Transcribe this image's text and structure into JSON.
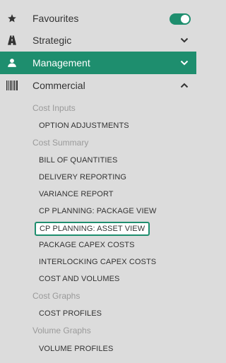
{
  "nav": {
    "items": [
      {
        "label": "Favourites",
        "icon": "star-icon"
      },
      {
        "label": "Strategic",
        "icon": "road-icon"
      },
      {
        "label": "Management",
        "icon": "user-icon"
      },
      {
        "label": "Commercial",
        "icon": "barcode-icon"
      }
    ],
    "favourites_toggle": "on",
    "accent_color": "#1e8e6e"
  },
  "commercial": {
    "groups": {
      "cost_inputs": "Cost Inputs",
      "cost_summary": "Cost Summary",
      "cost_graphs": "Cost Graphs",
      "volume_graphs": "Volume Graphs"
    },
    "links": {
      "option_adjustments": "OPTION ADJUSTMENTS",
      "bill_of_quantities": "BILL OF QUANTITIES",
      "delivery_reporting": "DELIVERY REPORTING",
      "variance_report": "VARIANCE REPORT",
      "cp_planning_package": "CP PLANNING: PACKAGE VIEW",
      "cp_planning_asset": "CP PLANNING: ASSET VIEW",
      "package_capex": "PACKAGE CAPEX COSTS",
      "interlocking_capex": "INTERLOCKING CAPEX COSTS",
      "cost_and_volumes": "COST AND VOLUMES",
      "cost_profiles": "COST PROFILES",
      "volume_profiles": "VOLUME PROFILES"
    },
    "selected_link": "CP PLANNING: ASSET VIEW"
  }
}
